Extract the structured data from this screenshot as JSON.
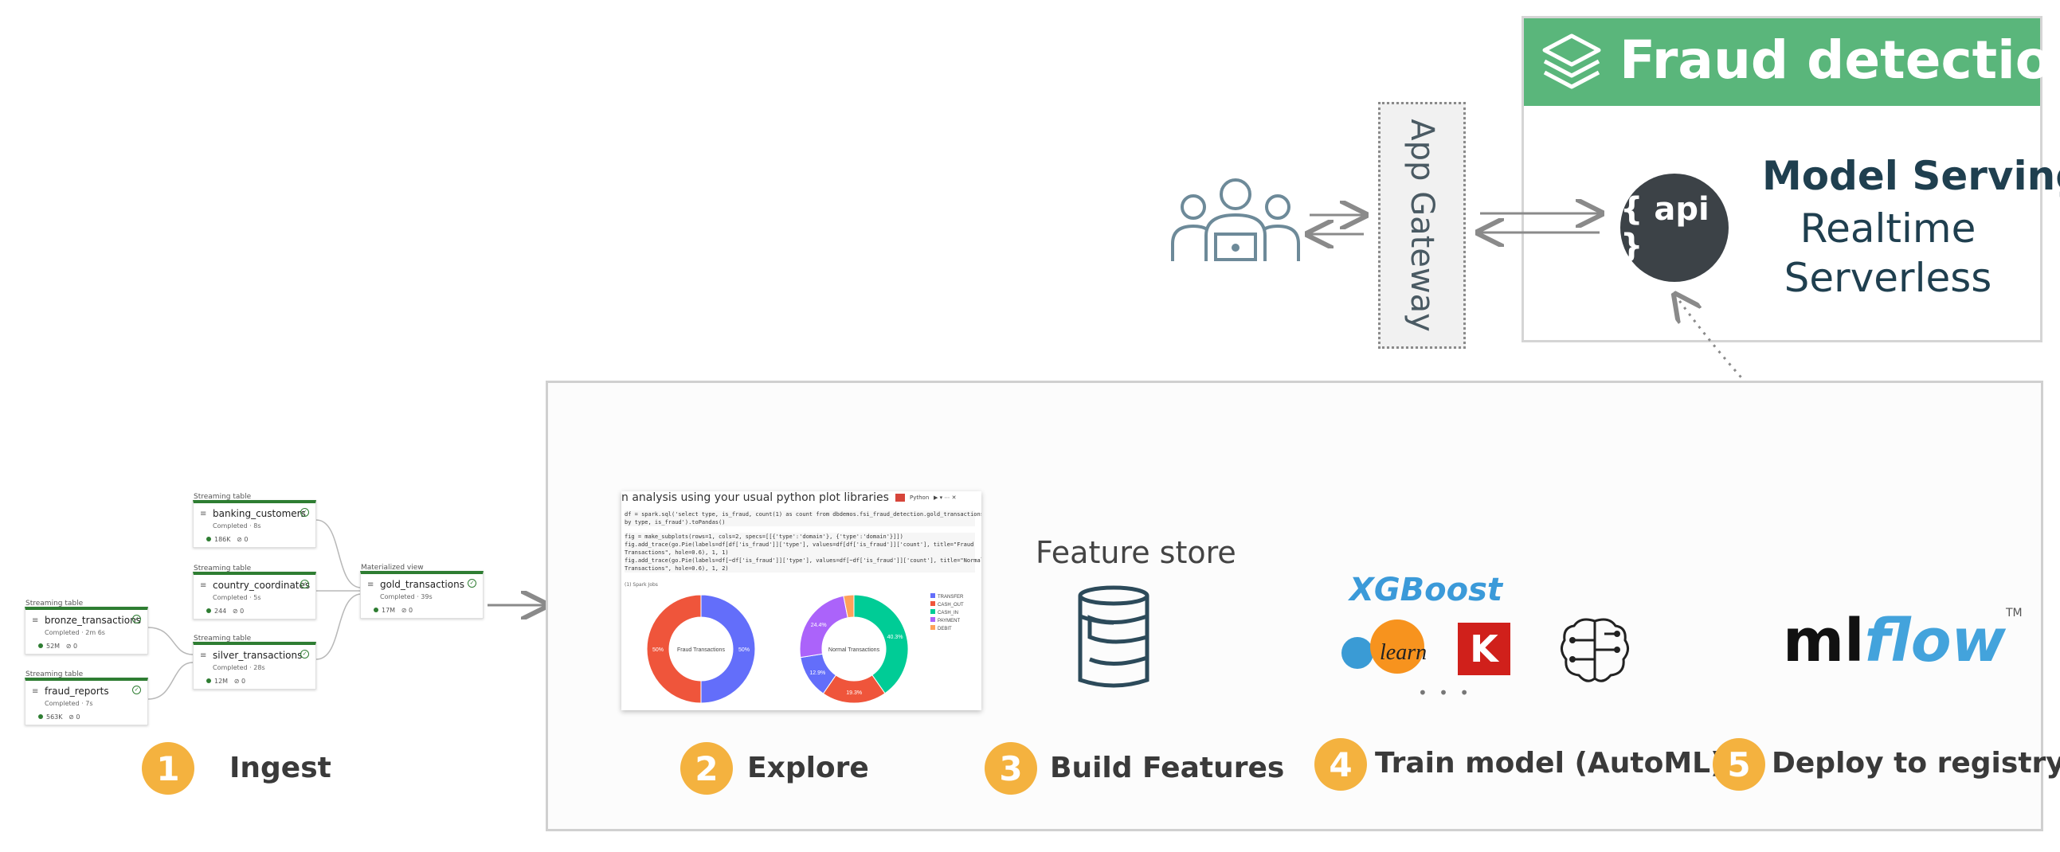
{
  "fraud": {
    "title": "Fraud detection"
  },
  "serving": {
    "title": "Model Serving",
    "line1": "Realtime",
    "line2": "Serverless",
    "api_label": "{ api }"
  },
  "gateway": {
    "label": "App Gateway"
  },
  "ingest": {
    "nodes": [
      {
        "kind": "Streaming table",
        "name": "bronze_transactions",
        "status": "Completed · 2m 6s",
        "rows": "52M",
        "dropped": "0"
      },
      {
        "kind": "Streaming table",
        "name": "fraud_reports",
        "status": "Completed · 7s",
        "rows": "563K",
        "dropped": "0"
      },
      {
        "kind": "Streaming table",
        "name": "banking_customers",
        "status": "Completed · 8s",
        "rows": "186K",
        "dropped": "0"
      },
      {
        "kind": "Streaming table",
        "name": "country_coordinates",
        "status": "Completed · 5s",
        "rows": "244",
        "dropped": "0"
      },
      {
        "kind": "Streaming table",
        "name": "silver_transactions",
        "status": "Completed · 28s",
        "rows": "12M",
        "dropped": "0"
      },
      {
        "kind": "Materialized view",
        "name": "gold_transactions",
        "status": "Completed · 39s",
        "rows": "17M",
        "dropped": "0"
      }
    ]
  },
  "notebook": {
    "title": "n analysis using your usual python plot libraries",
    "lang": "Python",
    "code1": [
      "df = spark.sql('select type, is_fraud, count(1) as count from dbdemos.fsi_fraud_detection.gold_transactions group",
      "by type, is_fraud').toPandas()"
    ],
    "code2": [
      "fig = make_subplots(rows=1, cols=2, specs=[[{'type':'domain'}, {'type':'domain'}]])",
      "fig.add_trace(go.Pie(labels=df[df['is_fraud']]['type'], values=df[df['is_fraud']]['count'], title=\"Fraud",
      "Transactions\", hole=0.6), 1, 1)",
      "fig.add_trace(go.Pie(labels=df[~df['is_fraud']]['type'], values=df[~df['is_fraud']]['count'], title=\"Normal",
      "Transactions\", hole=0.6), 1, 2)"
    ],
    "jobs": "(1) Spark Jobs",
    "chart_data": [
      {
        "type": "pie",
        "title": "Fraud Transactions",
        "labels": [
          "TRANSFER",
          "CASH_OUT"
        ],
        "values": [
          50,
          50
        ],
        "printed": [
          "50%",
          "50%"
        ]
      },
      {
        "type": "pie",
        "title": "Normal Transactions",
        "labels": [
          "CASH_IN",
          "CASH_OUT",
          "TRANSFER",
          "PAYMENT",
          "DEBIT"
        ],
        "values": [
          40.3,
          19.3,
          12.9,
          24.4,
          3.1
        ],
        "printed": [
          "40.3%",
          "19.3%",
          "12.9%",
          "24.4%",
          ""
        ]
      }
    ],
    "legend": [
      "TRANSFER",
      "CASH_OUT",
      "CASH_IN",
      "PAYMENT",
      "DEBIT"
    ]
  },
  "feature_store": {
    "label": "Feature store"
  },
  "train": {
    "xgboost": "XGBoost",
    "sk": "learn",
    "keras": "K",
    "more": "• • •"
  },
  "mlflow": {
    "ml": "ml",
    "flow": "flow",
    "tm": "TM"
  },
  "steps": [
    {
      "num": "1",
      "label": "Ingest"
    },
    {
      "num": "2",
      "label": "Explore"
    },
    {
      "num": "3",
      "label": "Build Features"
    },
    {
      "num": "4",
      "label": "Train model (AutoML)"
    },
    {
      "num": "5",
      "label": "Deploy to registry"
    }
  ],
  "colors": {
    "green_header": "#5ab67b",
    "badge": "#f4b23f",
    "api_dark": "#3c4247",
    "transfer": "#636efa",
    "cash_out": "#ef553b",
    "cash_in": "#00cc96",
    "payment": "#ab63fa",
    "debit": "#ffa15a"
  }
}
